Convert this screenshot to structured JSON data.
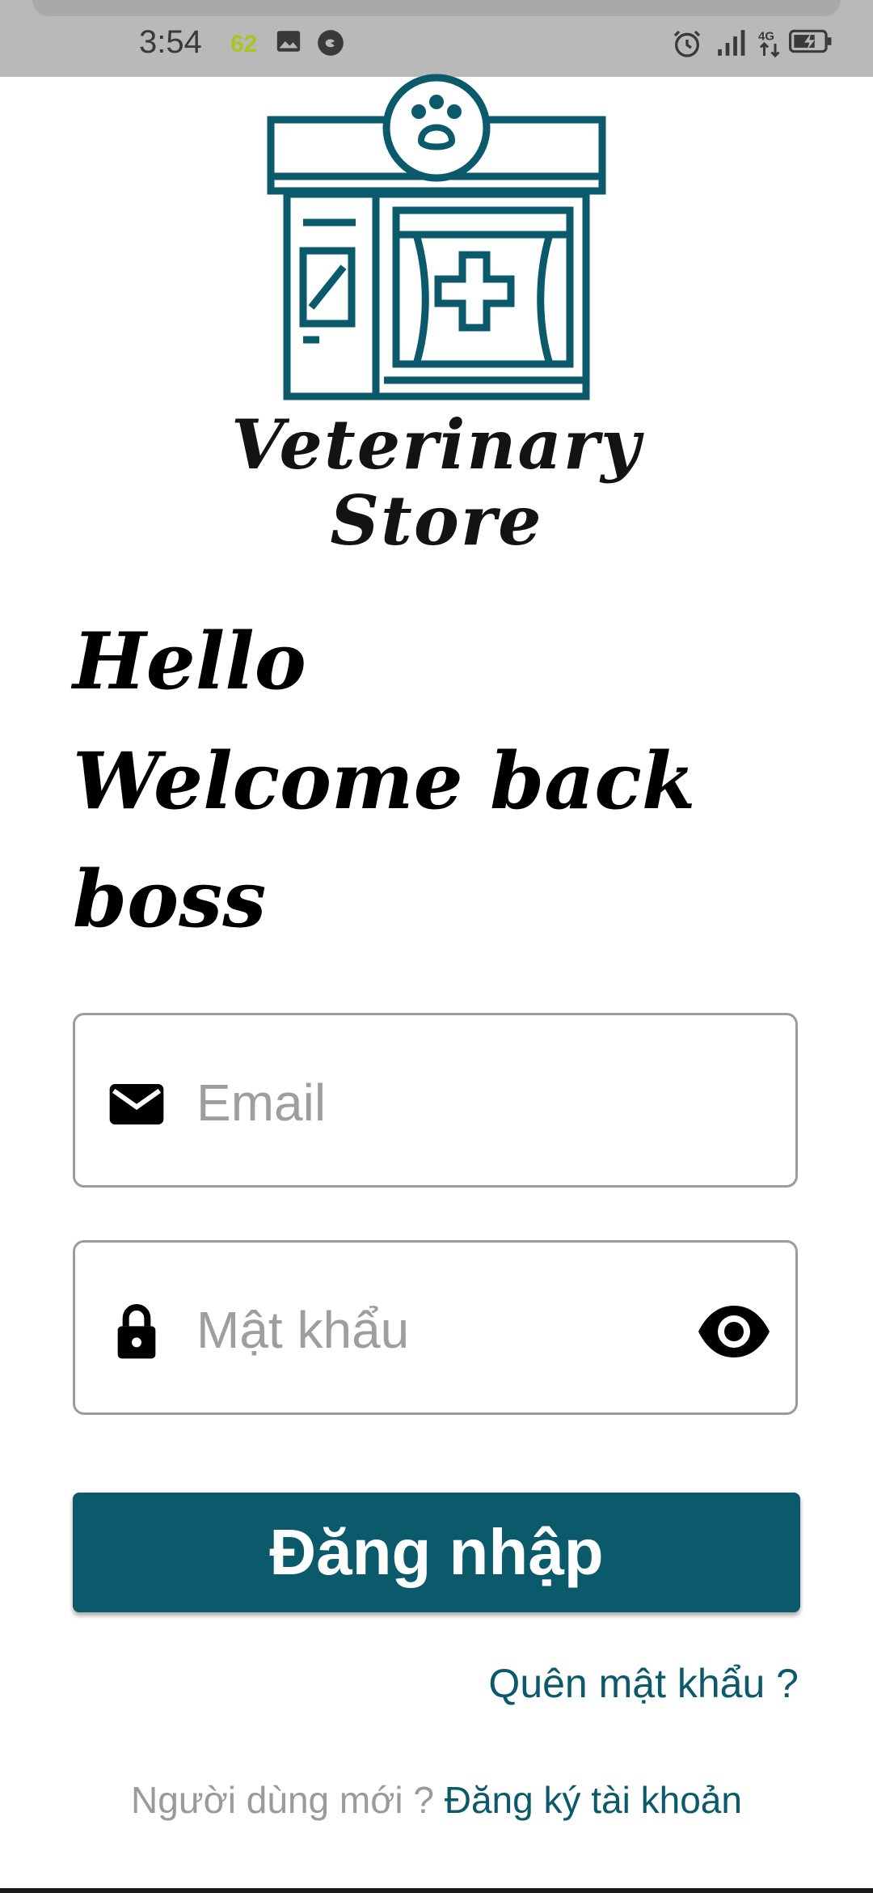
{
  "status_bar": {
    "time": "3:54",
    "badge": "62",
    "icons": [
      "image-icon",
      "chat-bubble-icon",
      "alarm-icon",
      "signal-icon",
      "network-4g-icon",
      "battery-charging-icon"
    ]
  },
  "logo": {
    "icon": "veterinary-store-building-icon",
    "line1": "Veterinary",
    "line2": "Store"
  },
  "greeting": {
    "line1": "Hello",
    "line2": "Welcome back",
    "line3": "boss"
  },
  "form": {
    "email_placeholder": "Email",
    "email_value": "",
    "email_icon": "mail-icon",
    "password_placeholder": "Mật khẩu",
    "password_value": "",
    "password_icon": "lock-icon",
    "toggle_icon": "eye-icon"
  },
  "actions": {
    "login_label": "Đăng nhập",
    "forgot_label": "Quên mật khẩu ?",
    "new_user_label": "Người dùng mới ?",
    "register_label": "Đăng ký tài khoản"
  },
  "colors": {
    "primary": "#0b5a6b",
    "status_bar": "#b9b9b9",
    "placeholder": "#9e9e9e"
  }
}
